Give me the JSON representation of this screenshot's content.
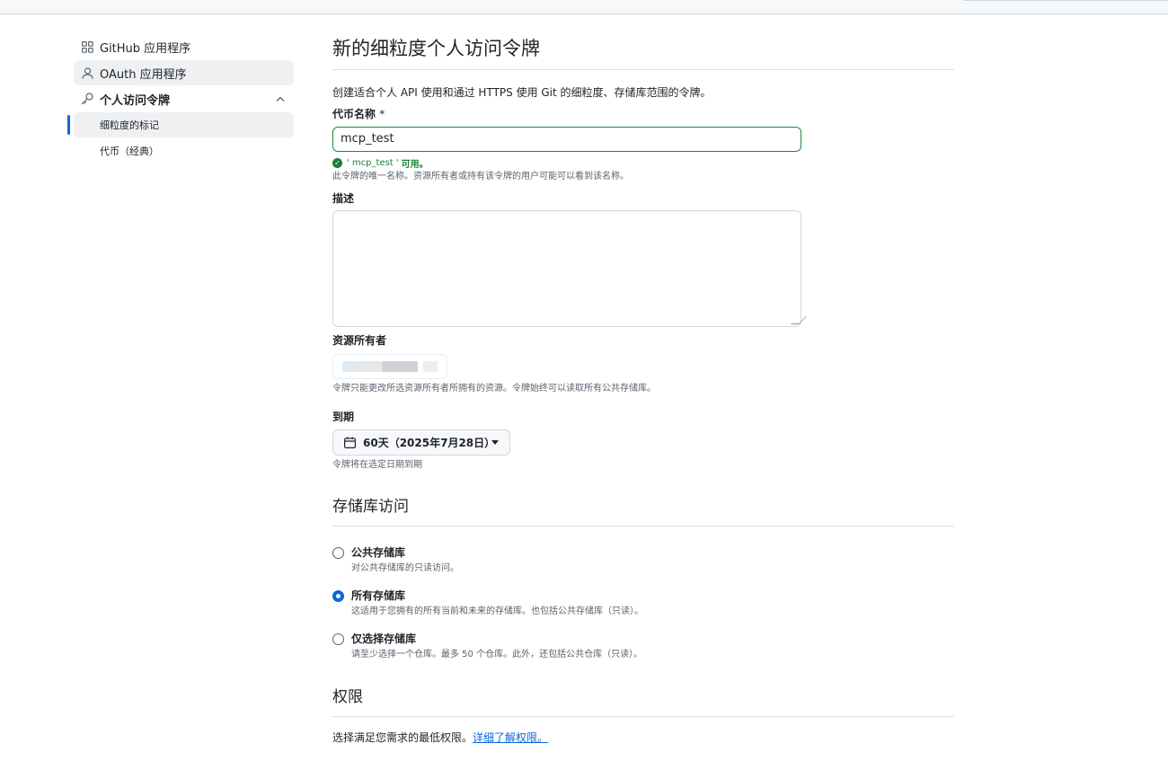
{
  "sidebar": {
    "items": [
      {
        "label": "GitHub 应用程序",
        "icon": "apps-icon"
      },
      {
        "label": "OAuth 应用程序",
        "icon": "person-icon"
      },
      {
        "label": "个人访问令牌",
        "icon": "key-icon",
        "expanded": true
      }
    ],
    "sub_items": [
      {
        "label": "细粒度的标记",
        "active": true
      },
      {
        "label": "代币（经典）",
        "active": false
      }
    ]
  },
  "page": {
    "title": "新的细粒度个人访问令牌",
    "description": "创建适合个人 API 使用和通过 HTTPS 使用 Git 的细粒度、存储库范围的令牌。"
  },
  "token_name": {
    "label": "代币名称",
    "required_mark": "*",
    "value": "mcp_test",
    "status_name": "' mcp_test '",
    "status_text": "可用。",
    "hint": "此令牌的唯一名称。资源所有者或持有该令牌的用户可能可以看到该名称。"
  },
  "description_field": {
    "label": "描述",
    "value": ""
  },
  "resource_owner": {
    "label": "资源所有者",
    "hint": "令牌只能更改所选资源所有者所拥有的资源。令牌始终可以读取所有公共存储库。"
  },
  "expiration": {
    "label": "到期",
    "value": "60天（2025年7月28日）",
    "hint": "令牌将在选定日期到期"
  },
  "repo_access": {
    "title": "存储库访问",
    "options": [
      {
        "label": "公共存储库",
        "hint": "对公共存储库的只读访问。",
        "checked": false
      },
      {
        "label": "所有存储库",
        "hint": "这适用于您拥有的所有当前和未来的存储库。也包括公共存储库（只读）。",
        "checked": true
      },
      {
        "label": "仅选择存储库",
        "hint": "请至少选择一个仓库。最多 50 个仓库。此外，还包括公共仓库（只读）。",
        "checked": false
      }
    ]
  },
  "permissions": {
    "title": "权限",
    "text": "选择满足您需求的最低权限。",
    "link": "详细了解权限。"
  },
  "colors": {
    "accent": "#0969da",
    "success": "#1a7f37",
    "border": "#d0d7de"
  }
}
